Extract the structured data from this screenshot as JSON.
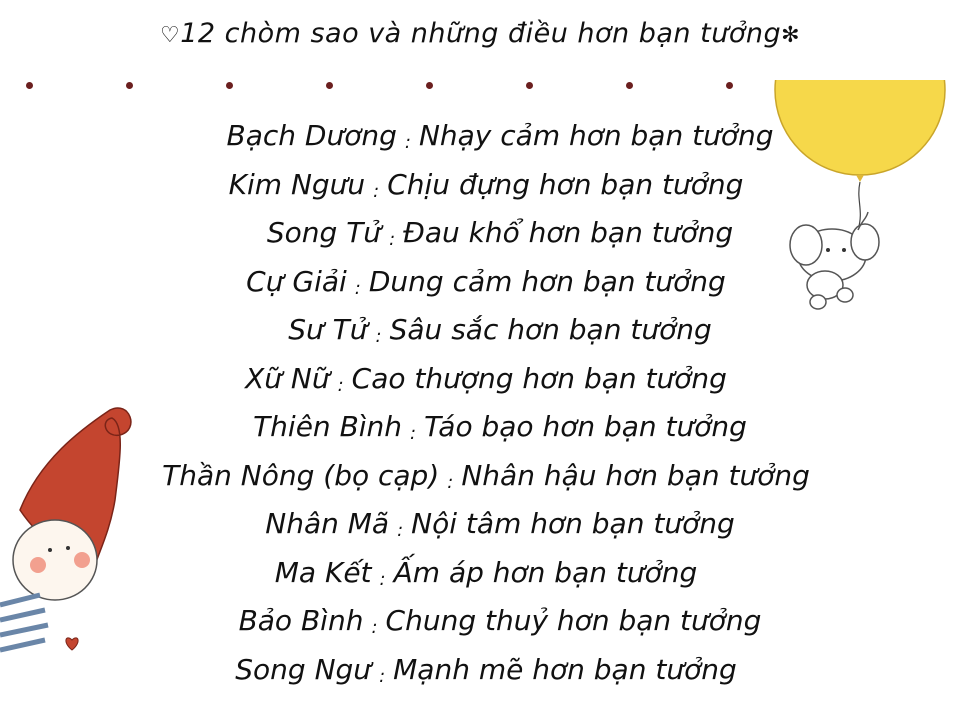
{
  "title": {
    "heart": "♡",
    "text": "12 chòm sao và những điều hơn bạn tưởng",
    "flower": "✻"
  },
  "signs": [
    {
      "name": "Bạch Dương",
      "sep": ":",
      "trait": "Nhạy cảm hơn bạn tưởng"
    },
    {
      "name": "Kim Ngưu",
      "sep": ":",
      "trait": "Chịu đựng hơn bạn tưởng"
    },
    {
      "name": "Song Tử",
      "sep": ":",
      "trait": "Đau khổ hơn bạn tưởng"
    },
    {
      "name": "Cự Giải",
      "sep": ":",
      "trait": "Dung cảm hơn bạn tưởng"
    },
    {
      "name": "Sư Tử",
      "sep": ":",
      "trait": "Sâu sắc hơn bạn tưởng"
    },
    {
      "name": "Xữ Nữ",
      "sep": ":",
      "trait": "Cao thượng hơn bạn tưởng"
    },
    {
      "name": "Thiên Bình",
      "sep": ":",
      "trait": "Táo bạo hơn bạn tưởng"
    },
    {
      "name": "Thần Nông (bọ cạp)",
      "sep": ":",
      "trait": "Nhân hậu hơn bạn tưởng"
    },
    {
      "name": "Nhân Mã",
      "sep": ":",
      "trait": "Nội tâm hơn bạn tưởng"
    },
    {
      "name": "Ma Kết",
      "sep": ":",
      "trait": "Ấm áp hơn bạn tưởng"
    },
    {
      "name": "Bảo Bình",
      "sep": ":",
      "trait": "Chung thuỷ hơn bạn tưởng"
    },
    {
      "name": "Song Ngư",
      "sep": ":",
      "trait": "Mạnh mẽ hơn bạn tưởng"
    }
  ],
  "colors": {
    "dot": "#6b1f1f",
    "balloon": "#f6d84a",
    "hat": "#c4452f",
    "text": "#111111"
  },
  "illustrations": [
    "yellow-balloon",
    "elephant",
    "gnome-with-red-hat"
  ]
}
